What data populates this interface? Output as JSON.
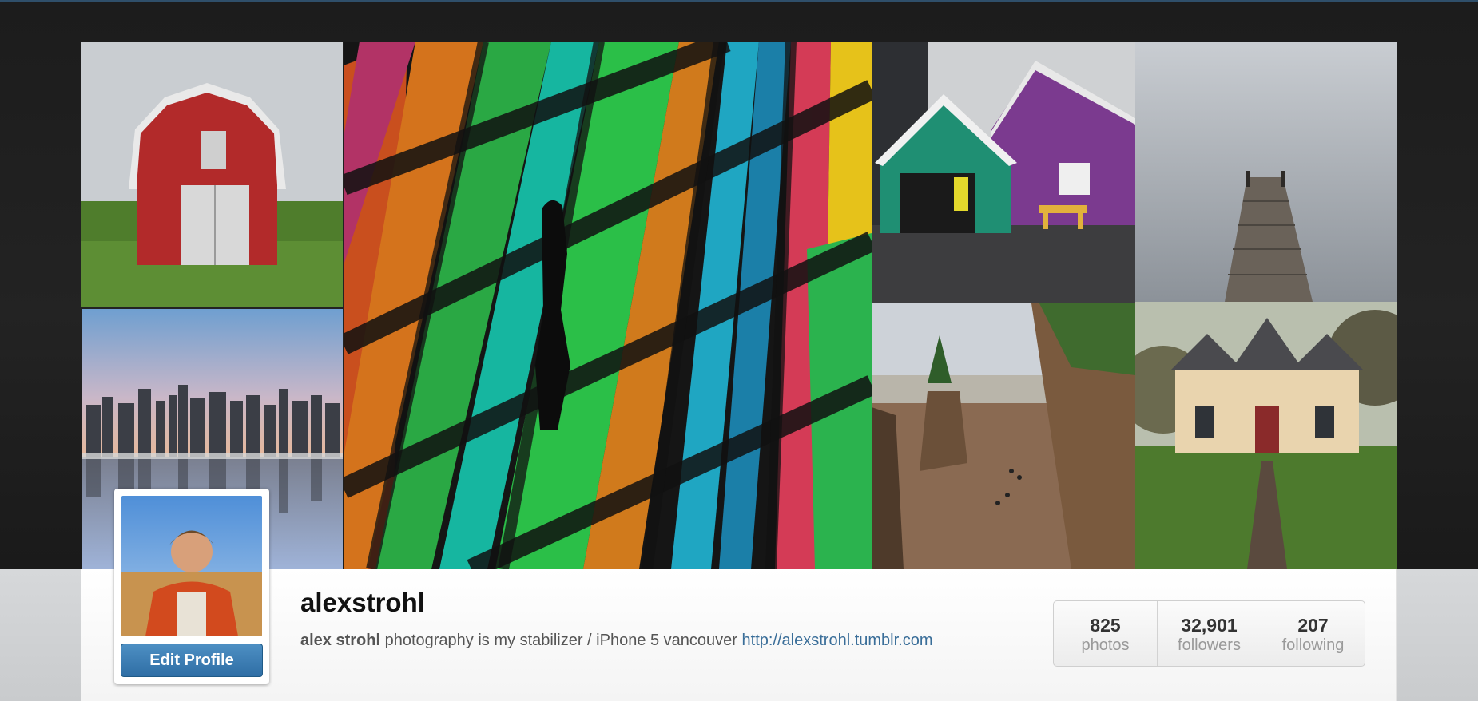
{
  "profile": {
    "username": "alexstrohl",
    "bio_name": "alex strohl",
    "bio_text": " photography is my stabilizer / iPhone 5 vancouver ",
    "bio_link": "http://alexstrohl.tumblr.com",
    "edit_button": "Edit Profile"
  },
  "stats": [
    {
      "value": "825",
      "label": "photos"
    },
    {
      "value": "32,901",
      "label": "followers"
    },
    {
      "value": "207",
      "label": "following"
    }
  ],
  "colors": {
    "accent_link": "#3a6e99",
    "button": "#3b7db4",
    "background_dark": "#1b1b1b"
  }
}
